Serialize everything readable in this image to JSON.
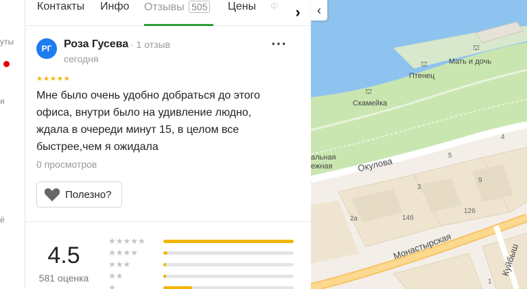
{
  "tabs": {
    "contacts": "Контакты",
    "info": "Инфо",
    "reviews": "Отзывы",
    "reviews_count": "505",
    "prices": "Цены",
    "cut_off": "Ф",
    "next_icon": "chevron-right-icon"
  },
  "left_strip": {
    "line1": "уты",
    "line2": "я",
    "line3": "ё"
  },
  "review": {
    "avatar_initials": "РГ",
    "author": "Роза Гусева",
    "author_meta": "· 1 отзыв",
    "date": "сегодня",
    "stars": "★★★★★",
    "text": "Мне было очень удобно добраться до этого офиса, внутри было на удивление людно, ждала в очереди минут 15, в целом все быстрее,чем я ожидала",
    "views": "0 просмотров",
    "helpful_label": "Полезно?",
    "menu_icon": "more-dots-icon"
  },
  "rating": {
    "value": "4.5",
    "count": "581 оценка",
    "distribution": [
      {
        "stars": "★★★★★",
        "fraction": 1.0
      },
      {
        "stars": "★★★★",
        "fraction": 0.03
      },
      {
        "stars": "★★★",
        "fraction": 0.02
      },
      {
        "stars": "★★",
        "fraction": 0.02
      },
      {
        "stars": "★",
        "fraction": 0.22
      }
    ]
  },
  "map": {
    "collapse_icon": "chevron-left-icon",
    "labels": {
      "mother_daughter": "Мать и дочь",
      "chick": "Птенец",
      "bench": "Скамейка",
      "okulova": "Окулова",
      "monastyrskaya": "Монастырская",
      "kuybysheva": "Куйбыш",
      "embankment_1": "альная",
      "embankment_2": "ежная"
    },
    "houses": {
      "h4": "4",
      "h5": "5",
      "h3": "3",
      "h9": "9",
      "h12b": "12б",
      "h14b": "14б",
      "h2a": "2а",
      "h1": "1"
    }
  }
}
